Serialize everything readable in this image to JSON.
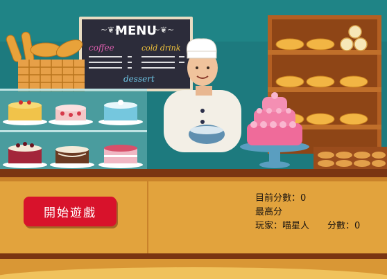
{
  "menu_board": {
    "title": "MENU",
    "coffee": "coffee",
    "cold_drink": "cold drink",
    "dessert": "dessert"
  },
  "buttons": {
    "start": "開始遊戲"
  },
  "hud": {
    "current_score": "目前分數：0",
    "high_score": "最高分",
    "player": "玩家：喵星人",
    "player_score": "分數：0"
  },
  "colors": {
    "wall": "#1d7a7e",
    "counter": "#e2a33d",
    "button": "#d8122b",
    "board": "#2c2c3a"
  },
  "icons": [
    "bread-basket-icon",
    "cake-icon",
    "chef-icon",
    "croissant-icon"
  ]
}
